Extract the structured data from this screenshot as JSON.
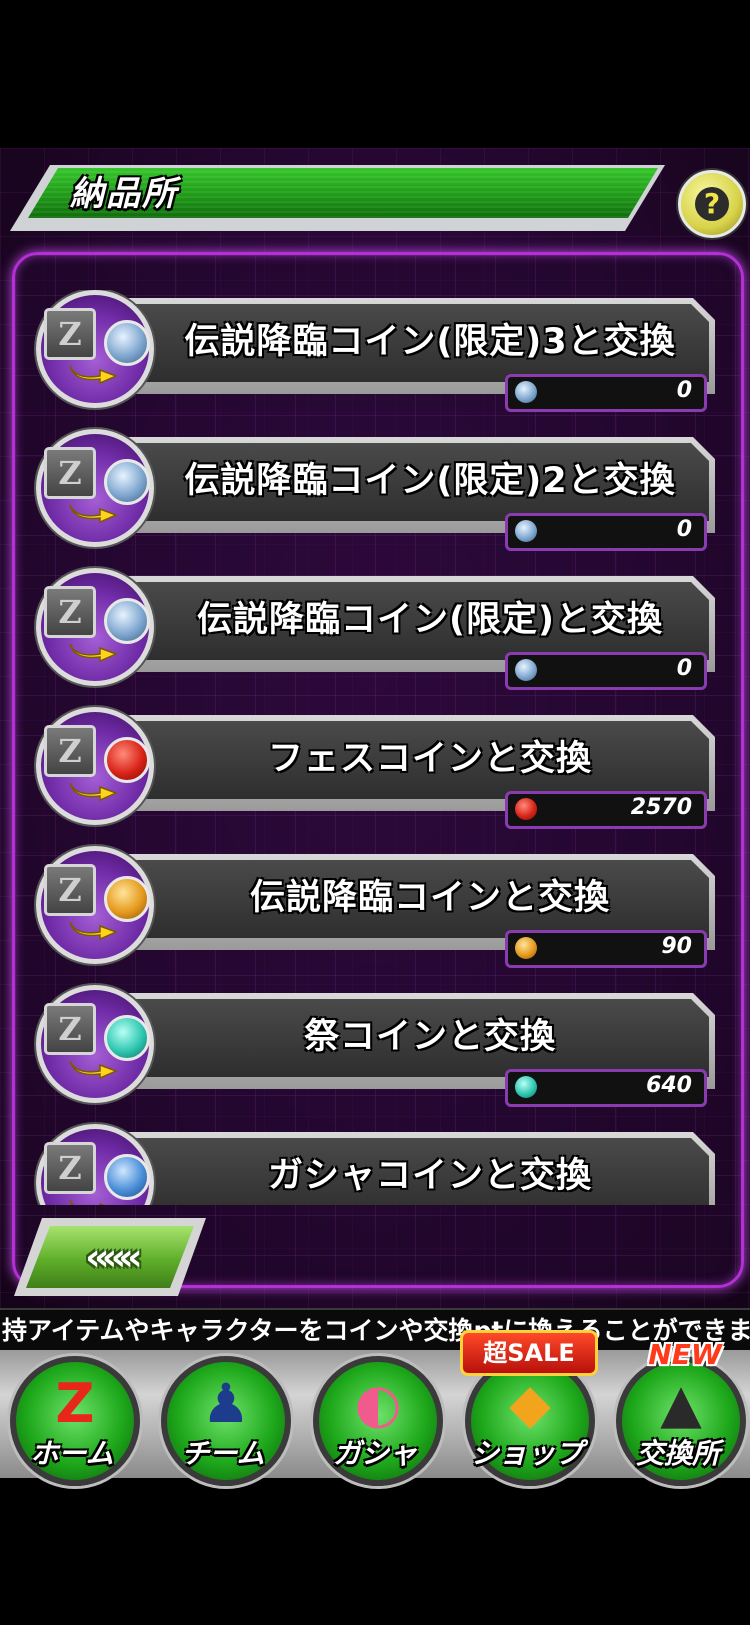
{
  "header": {
    "title": "納品所",
    "help_symbol": "?"
  },
  "items": [
    {
      "label": "伝説降臨コイン(限定)3と交換",
      "count": "0",
      "coin": "silver-star-coin-icon",
      "coin_class": "coin-silver"
    },
    {
      "label": "伝説降臨コイン(限定)2と交換",
      "count": "0",
      "coin": "silver-star-coin-icon",
      "coin_class": "coin-silver"
    },
    {
      "label": "伝説降臨コイン(限定)と交換",
      "count": "0",
      "coin": "silver-coin-icon",
      "coin_class": "coin-silver"
    },
    {
      "label": "フェスコインと交換",
      "count": "2570",
      "coin": "red-coin-icon",
      "coin_class": "coin-red"
    },
    {
      "label": "伝説降臨コインと交換",
      "count": "90",
      "coin": "gold-coin-icon",
      "coin_class": "coin-gold"
    },
    {
      "label": "祭コインと交換",
      "count": "640",
      "coin": "teal-coin-icon",
      "coin_class": "coin-teal"
    },
    {
      "label": "ガシャコインと交換",
      "count": "",
      "coin": "blue-coin-icon",
      "coin_class": "coin-blue"
    }
  ],
  "back_button": {
    "label": "«««"
  },
  "ticker": {
    "text": "持アイテムやキャラクターをコインや交換ptに換えることができます"
  },
  "nav": {
    "items": [
      {
        "label": "ホーム",
        "icon": "z-logo-icon"
      },
      {
        "label": "チーム",
        "icon": "team-characters-icon"
      },
      {
        "label": "ガシャ",
        "icon": "gasha-capsule-icon"
      },
      {
        "label": "ショップ",
        "icon": "dragon-stones-icon"
      },
      {
        "label": "交換所",
        "icon": "exchange-character-icon"
      }
    ],
    "sale_badge": "超SALE",
    "new_badge": "NEW"
  },
  "colors": {
    "title_green": "#1e9a18",
    "panel_purple": "#b52ed8",
    "nav_green": "#1ea81b"
  }
}
